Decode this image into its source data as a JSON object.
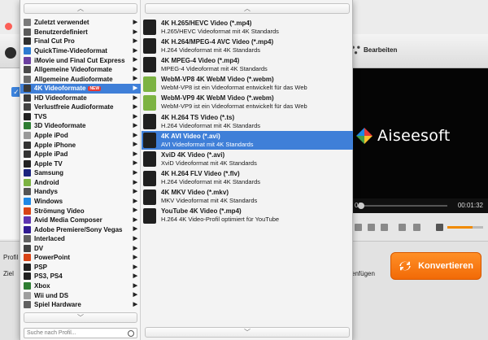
{
  "app": {
    "edit_label": "Bearbeiten",
    "profile_label": "Profil",
    "target_label": "Ziel",
    "add_label": "enfügen",
    "convert_label": "Konvertieren",
    "brand_text": "Aiseesoft",
    "time_current": "00",
    "time_total": "00:01:32"
  },
  "categories": [
    {
      "label": "Zuletzt verwendet",
      "icon": "recent-icon",
      "color": "#7a7a7a"
    },
    {
      "label": "Benutzerdefiniert",
      "icon": "custom-icon",
      "color": "#5b5b5b"
    },
    {
      "label": "Final Cut Pro",
      "icon": "final-cut-icon",
      "color": "#303030"
    },
    {
      "label": "QuickTime-Videoformat",
      "icon": "quicktime-icon",
      "color": "#2d7bd1"
    },
    {
      "label": "iMovie und Final Cut Express",
      "icon": "imovie-icon",
      "color": "#6b3fa0"
    },
    {
      "label": "Allgemeine Videoformate",
      "icon": "video-icon",
      "color": "#4a4a4a"
    },
    {
      "label": "Allgemeine Audioformate",
      "icon": "audio-icon",
      "color": "#6b6b6b"
    },
    {
      "label": "4K Videoformate",
      "icon": "4k-icon",
      "color": "#3a3a3a",
      "badge": "NEW",
      "selected": true
    },
    {
      "label": "HD Videoformate",
      "icon": "hd-icon",
      "color": "#3a3a3a"
    },
    {
      "label": "Verlustfreie Audioformate",
      "icon": "lossless-icon",
      "color": "#444444"
    },
    {
      "label": "TVS",
      "icon": "tv-icon",
      "color": "#222222"
    },
    {
      "label": "3D Videoformate",
      "icon": "3d-icon",
      "color": "#2e7d32"
    },
    {
      "label": "Apple iPod",
      "icon": "ipod-icon",
      "color": "#999999"
    },
    {
      "label": "Apple iPhone",
      "icon": "iphone-icon",
      "color": "#333333"
    },
    {
      "label": "Apple iPad",
      "icon": "ipad-icon",
      "color": "#333333"
    },
    {
      "label": "Apple TV",
      "icon": "apple-tv-icon",
      "color": "#222222"
    },
    {
      "label": "Samsung",
      "icon": "samsung-icon",
      "color": "#1a237e"
    },
    {
      "label": "Android",
      "icon": "android-icon",
      "color": "#7cb342"
    },
    {
      "label": "Handys",
      "icon": "phone-icon",
      "color": "#555555"
    },
    {
      "label": "Windows",
      "icon": "windows-icon",
      "color": "#1e88e5"
    },
    {
      "label": "Strömung Video",
      "icon": "streaming-icon",
      "color": "#d84315"
    },
    {
      "label": "Avid Media Composer",
      "icon": "avid-icon",
      "color": "#5e35b1"
    },
    {
      "label": "Adobe Premiere/Sony Vegas",
      "icon": "adobe-icon",
      "color": "#311b92"
    },
    {
      "label": "Interlaced",
      "icon": "interlaced-icon",
      "color": "#616161"
    },
    {
      "label": "DV",
      "icon": "dv-icon",
      "color": "#424242"
    },
    {
      "label": "PowerPoint",
      "icon": "powerpoint-icon",
      "color": "#d84315"
    },
    {
      "label": "PSP",
      "icon": "psp-icon",
      "color": "#212121"
    },
    {
      "label": "PS3, PS4",
      "icon": "playstation-icon",
      "color": "#212121"
    },
    {
      "label": "Xbox",
      "icon": "xbox-icon",
      "color": "#2e7d32"
    },
    {
      "label": "Wii und DS",
      "icon": "wii-icon",
      "color": "#9e9e9e"
    },
    {
      "label": "Spiel Hardware",
      "icon": "game-icon",
      "color": "#616161"
    }
  ],
  "search": {
    "placeholder": "Suche nach Profil..."
  },
  "formats": [
    {
      "title": "4K H.265/HEVC Video (*.mp4)",
      "desc": "H.265/HEVC Videoformat mit 4K Standards",
      "icon": "4k-mp4-icon",
      "color": "#1f1f1f"
    },
    {
      "title": "4K H.264/MPEG-4 AVC Video (*.mp4)",
      "desc": "H.264 Videoformat mit 4K Standards",
      "icon": "4k-mp4-icon",
      "color": "#1f1f1f"
    },
    {
      "title": "4K MPEG-4 Video (*.mp4)",
      "desc": "MPEG-4 Videoformat mit 4K Standards",
      "icon": "4k-mp4-icon",
      "color": "#1f1f1f"
    },
    {
      "title": "WebM-VP8 4K WebM Video (*.webm)",
      "desc": "WebM-VP8 ist ein Videoformat entwickelt für das Web",
      "icon": "webm-icon",
      "color": "#7cb342"
    },
    {
      "title": "WebM-VP9 4K WebM Video (*.webm)",
      "desc": "WebM-VP9 ist ein Videoformat entwickelt für das Web",
      "icon": "webm-icon",
      "color": "#7cb342"
    },
    {
      "title": "4K H.264 TS Video (*.ts)",
      "desc": "H.264 Videoformat mit 4K Standards",
      "icon": "4k-ts-icon",
      "color": "#1f1f1f"
    },
    {
      "title": "4K AVI Video (*.avi)",
      "desc": "AVI Videoformat mit 4K Standards",
      "icon": "4k-avi-icon",
      "color": "#1f1f1f",
      "selected": true
    },
    {
      "title": "XviD 4K Video (*.avi)",
      "desc": "XviD Videoformat mit 4K Standards",
      "icon": "4k-avi-icon",
      "color": "#1f1f1f"
    },
    {
      "title": "4K H.264 FLV Video (*.flv)",
      "desc": "H.264 Videoformat mit 4K Standards",
      "icon": "4k-flv-icon",
      "color": "#1f1f1f"
    },
    {
      "title": "4K MKV Video (*.mkv)",
      "desc": "MKV Videoformat mit 4K Standards",
      "icon": "4k-mkv-icon",
      "color": "#1f1f1f"
    },
    {
      "title": "YouTube 4K Video (*.mp4)",
      "desc": "H.264 4K Video-Profil optimiert für YouTube",
      "icon": "youtube-icon",
      "color": "#1f1f1f"
    }
  ],
  "colors": {
    "selection": "#3f7fd8",
    "convert": "#f27a0f",
    "new_badge": "#e53935"
  }
}
